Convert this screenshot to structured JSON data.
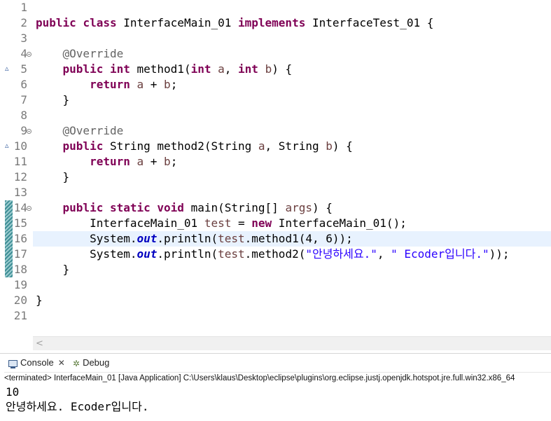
{
  "editor": {
    "line_numbers": [
      "1",
      "2",
      "3",
      "4",
      "5",
      "6",
      "7",
      "8",
      "9",
      "10",
      "11",
      "12",
      "13",
      "14",
      "15",
      "16",
      "17",
      "18",
      "19",
      "20",
      "21"
    ],
    "lines": [
      [],
      [
        {
          "t": "public",
          "c": "kw"
        },
        {
          "t": " "
        },
        {
          "t": "class",
          "c": "kw"
        },
        {
          "t": " InterfaceMain_01 "
        },
        {
          "t": "implements",
          "c": "kw"
        },
        {
          "t": " InterfaceTest_01 {"
        }
      ],
      [],
      [
        {
          "t": "    "
        },
        {
          "t": "@Override",
          "c": "ann"
        }
      ],
      [
        {
          "t": "    "
        },
        {
          "t": "public",
          "c": "kw"
        },
        {
          "t": " "
        },
        {
          "t": "int",
          "c": "kw"
        },
        {
          "t": " method1("
        },
        {
          "t": "int",
          "c": "kw"
        },
        {
          "t": " "
        },
        {
          "t": "a",
          "c": "var"
        },
        {
          "t": ", "
        },
        {
          "t": "int",
          "c": "kw"
        },
        {
          "t": " "
        },
        {
          "t": "b",
          "c": "var"
        },
        {
          "t": ") {"
        }
      ],
      [
        {
          "t": "        "
        },
        {
          "t": "return",
          "c": "kw"
        },
        {
          "t": " "
        },
        {
          "t": "a",
          "c": "var"
        },
        {
          "t": " + "
        },
        {
          "t": "b",
          "c": "var"
        },
        {
          "t": ";"
        }
      ],
      [
        {
          "t": "    }"
        }
      ],
      [],
      [
        {
          "t": "    "
        },
        {
          "t": "@Override",
          "c": "ann"
        }
      ],
      [
        {
          "t": "    "
        },
        {
          "t": "public",
          "c": "kw"
        },
        {
          "t": " String method2(String "
        },
        {
          "t": "a",
          "c": "var"
        },
        {
          "t": ", String "
        },
        {
          "t": "b",
          "c": "var"
        },
        {
          "t": ") {"
        }
      ],
      [
        {
          "t": "        "
        },
        {
          "t": "return",
          "c": "kw"
        },
        {
          "t": " "
        },
        {
          "t": "a",
          "c": "var"
        },
        {
          "t": " + "
        },
        {
          "t": "b",
          "c": "var"
        },
        {
          "t": ";"
        }
      ],
      [
        {
          "t": "    }"
        }
      ],
      [],
      [
        {
          "t": "    "
        },
        {
          "t": "public",
          "c": "kw"
        },
        {
          "t": " "
        },
        {
          "t": "static",
          "c": "kw"
        },
        {
          "t": " "
        },
        {
          "t": "void",
          "c": "kw"
        },
        {
          "t": " main(String[] "
        },
        {
          "t": "args",
          "c": "var"
        },
        {
          "t": ") {"
        }
      ],
      [
        {
          "t": "        InterfaceMain_01 "
        },
        {
          "t": "test",
          "c": "var"
        },
        {
          "t": " = "
        },
        {
          "t": "new",
          "c": "kw"
        },
        {
          "t": " InterfaceMain_01();"
        }
      ],
      [
        {
          "t": "        System."
        },
        {
          "t": "out",
          "c": "fld"
        },
        {
          "t": ".println("
        },
        {
          "t": "test",
          "c": "var"
        },
        {
          "t": ".method1(4, 6));"
        }
      ],
      [
        {
          "t": "        System."
        },
        {
          "t": "out",
          "c": "fld"
        },
        {
          "t": ".println("
        },
        {
          "t": "test",
          "c": "var"
        },
        {
          "t": ".method2("
        },
        {
          "t": "\"안녕하세요.\"",
          "c": "str"
        },
        {
          "t": ", "
        },
        {
          "t": "\" Ecoder입니다.\"",
          "c": "str"
        },
        {
          "t": "));"
        }
      ],
      [
        {
          "t": "    }"
        }
      ],
      [],
      [
        {
          "t": "}"
        }
      ],
      []
    ],
    "fold_lines": [
      4,
      9,
      14
    ],
    "override_lines": [
      5,
      10
    ],
    "occurrence_lines": [
      14,
      15,
      16,
      17,
      18
    ],
    "current_line": 16,
    "scroll_left_glyph": "<"
  },
  "console": {
    "tab_console_label": "Console",
    "tab_close_glyph": "✕",
    "tab_debug_label": "Debug",
    "terminated_text": "<terminated> InterfaceMain_01 [Java Application] C:\\Users\\klaus\\Desktop\\eclipse\\plugins\\org.eclipse.justj.openjdk.hotspot.jre.full.win32.x86_64",
    "output_line_1": "10",
    "output_line_2": "안녕하세요. Ecoder입니다."
  },
  "icons": {
    "fold": "collapse-icon",
    "override": "override-marker-icon",
    "console": "console-icon",
    "debug": "debug-icon"
  }
}
